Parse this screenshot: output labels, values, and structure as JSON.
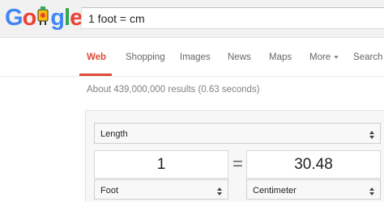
{
  "logo": {
    "text": "Google",
    "letters": [
      "G",
      "o",
      "",
      "g",
      "l",
      "e"
    ]
  },
  "search": {
    "query": "1 foot = cm"
  },
  "tabs": [
    {
      "label": "Web",
      "active": true
    },
    {
      "label": "Shopping"
    },
    {
      "label": "Images"
    },
    {
      "label": "News"
    },
    {
      "label": "Maps"
    },
    {
      "label": "More",
      "has_caret": true
    },
    {
      "label": "Search t"
    }
  ],
  "result_stats": "About 439,000,000 results (0.63 seconds)",
  "converter": {
    "category": "Length",
    "equals": "=",
    "from": {
      "value": "1",
      "unit": "Foot"
    },
    "to": {
      "value": "30.48",
      "unit": "Centimeter"
    }
  },
  "colors": {
    "accent": "#dd4b39",
    "brand_blue": "#4285f4",
    "brand_red": "#ea4335",
    "brand_yellow": "#fbbc05",
    "brand_green": "#34a853"
  }
}
